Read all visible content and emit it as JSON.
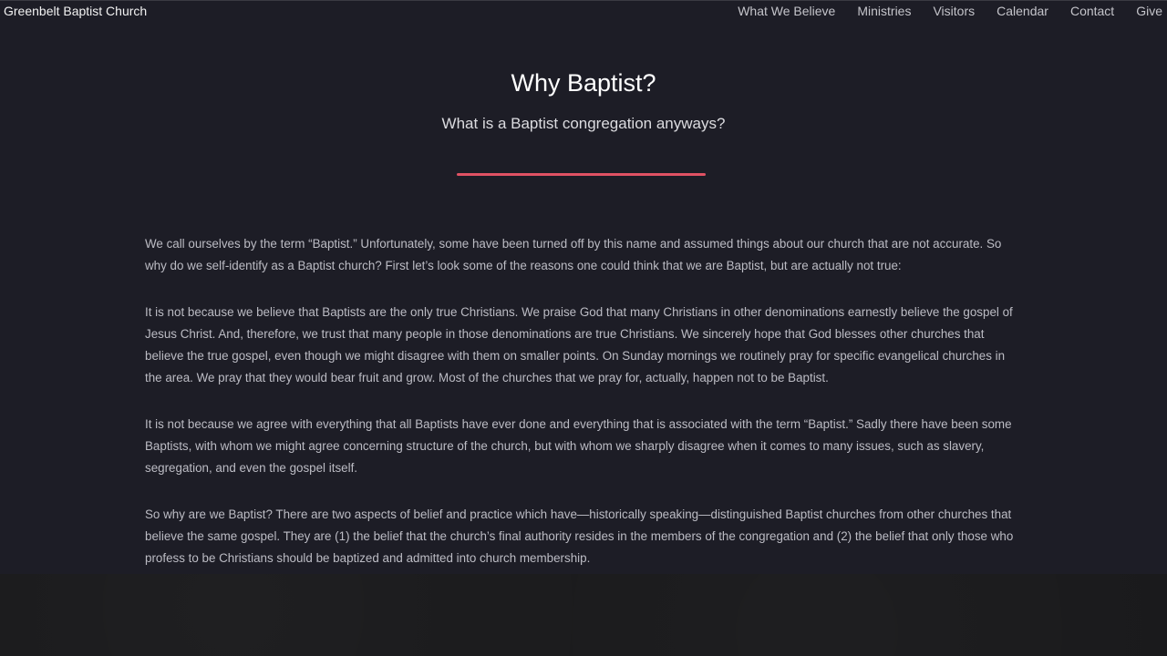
{
  "header": {
    "brand": "Greenbelt Baptist Church",
    "nav": [
      "What We Believe",
      "Ministries",
      "Visitors",
      "Calendar",
      "Contact",
      "Give"
    ]
  },
  "hero": {
    "title": "Why Baptist?",
    "subtitle": "What is a Baptist congregation anyways?"
  },
  "colors": {
    "background": "#1d1d26",
    "accent": "#e05264",
    "body_text": "#bcbcc4"
  },
  "content": {
    "paragraphs": [
      "We call ourselves by the term “Baptist.” Unfortunately, some have been turned off by this name and assumed things about our church that are not accurate. So why do we self-identify as a Baptist church? First let’s look some of the reasons one could think that we are Baptist, but are actually not true:",
      "It is not because we believe that Baptists are the only true Christians. We praise God that many Christians in other denominations earnestly believe the gospel of Jesus Christ. And, therefore, we trust that many people in those denominations are true Christians. We sincerely hope that God blesses other churches that believe the true gospel, even though we might disagree with them on smaller points. On Sunday mornings we routinely pray for specific evangelical churches in the area. We pray that they would bear fruit and grow. Most of the churches that we pray for, actually, happen not to be Baptist.",
      "It is not because we agree with everything that all Baptists have ever done and everything that is associated with the term “Baptist.” Sadly there have been some Baptists, with whom we might agree concerning structure of the church, but with whom we sharply disagree when it comes to many issues, such as slavery, segregation, and even the gospel itself.",
      "So why are we Baptist? There are two aspects of belief and practice which have—historically speaking—distinguished Baptist churches from other churches that believe the same gospel. They are (1) the belief that the church’s final authority resides in the members of the congregation and (2) the belief that only those who profess to be Christians should be baptized and admitted into church membership."
    ]
  }
}
